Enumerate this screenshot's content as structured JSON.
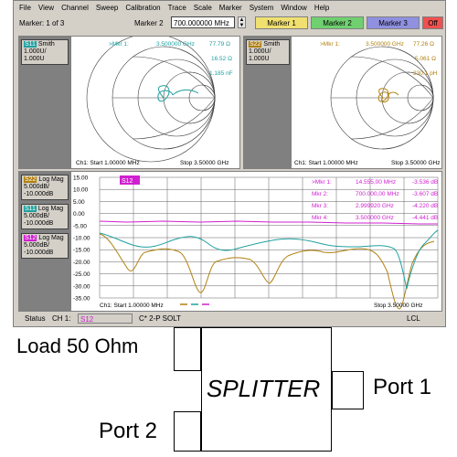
{
  "menu": [
    "File",
    "View",
    "Channel",
    "Sweep",
    "Calibration",
    "Trace",
    "Scale",
    "Marker",
    "System",
    "Window",
    "Help"
  ],
  "toolbar": {
    "marker_count": "Marker: 1 of 3",
    "marker_label": "Marker 2",
    "marker_value": "700.000000 MHz",
    "buttons": [
      {
        "label": "Marker 1",
        "color": "#f0e070"
      },
      {
        "label": "Marker 2",
        "color": "#70d070"
      },
      {
        "label": "Marker 3",
        "color": "#9090e0"
      },
      {
        "label": "Off",
        "color": "#f05050"
      }
    ]
  },
  "smith_left": {
    "tag_id": "S11",
    "tag_fmt": "Smith",
    "scale1": "1.000U/",
    "scale2": "1.000U",
    "marker_label": ">Mkr 1:",
    "marker_freq": "3.500000 GHz",
    "r": "77.79 Ω",
    "x": "16.52 Ω",
    "l": "1.185 nF",
    "footer_start": "Ch1: Start  1.00000 MHz",
    "footer_stop": "Stop  3.50000 GHz",
    "color": "#20a0a0"
  },
  "smith_right": {
    "tag_id": "S22",
    "tag_fmt": "Smith",
    "scale1": "1.000U/",
    "scale2": "1.000U",
    "marker_label": ">Mkr 1:",
    "marker_freq": "3.500000 GHz",
    "r": "77.26 Ω",
    "x": "5.061 Ω",
    "l": "230.1 pH",
    "footer_start": "Ch1: Start  1.00000 MHz",
    "footer_stop": "Stop  3.50000 GHz",
    "color": "#b08010"
  },
  "logmag": {
    "traces": [
      {
        "id": "S22",
        "fmt": "Log Mag",
        "s1": "5.000dB/",
        "s2": "-10.000dB",
        "color": "#b08010"
      },
      {
        "id": "S11",
        "fmt": "Log Mag",
        "s1": "5.000dB/",
        "s2": "-10.000dB",
        "color": "#20a0a0"
      },
      {
        "id": "S12",
        "fmt": "Log Mag",
        "s1": "5.000dB/",
        "s2": "-10.000dB",
        "color": "#d020d0"
      }
    ],
    "active_tag": "S12",
    "y_ticks": [
      "15.00",
      "10.00",
      "5.00",
      "0.00",
      "-5.00",
      "-10.00",
      "-15.00",
      "-20.00",
      "-25.00",
      "-30.00",
      "-35.00"
    ],
    "markers": [
      {
        "label": ">Mkr 1:",
        "freq": "14.555,00 MHz",
        "value": "-3.536 dB"
      },
      {
        "label": "Mkr 2:",
        "freq": "700.000,00 MHz",
        "value": "-3.607 dB"
      },
      {
        "label": "Mkr 3:",
        "freq": "2.999920 GHz",
        "value": "-4.220 dB"
      },
      {
        "label": "Mkr 4:",
        "freq": "3.500000 GHz",
        "value": "-4.441 dB"
      }
    ],
    "footer_start": "Ch1: Start  1.00000 MHz",
    "footer_stop": "Stop  3.50000 GHz"
  },
  "status": {
    "label": "Status",
    "channel": "CH 1:",
    "param": "S12",
    "cal": "C* 2-P SOLT",
    "mode": "LCL"
  },
  "diagram": {
    "load_label": "Load 50 Ohm",
    "center_label": "SPLITTER",
    "port1_label": "Port 1",
    "port2_label": "Port 2"
  }
}
